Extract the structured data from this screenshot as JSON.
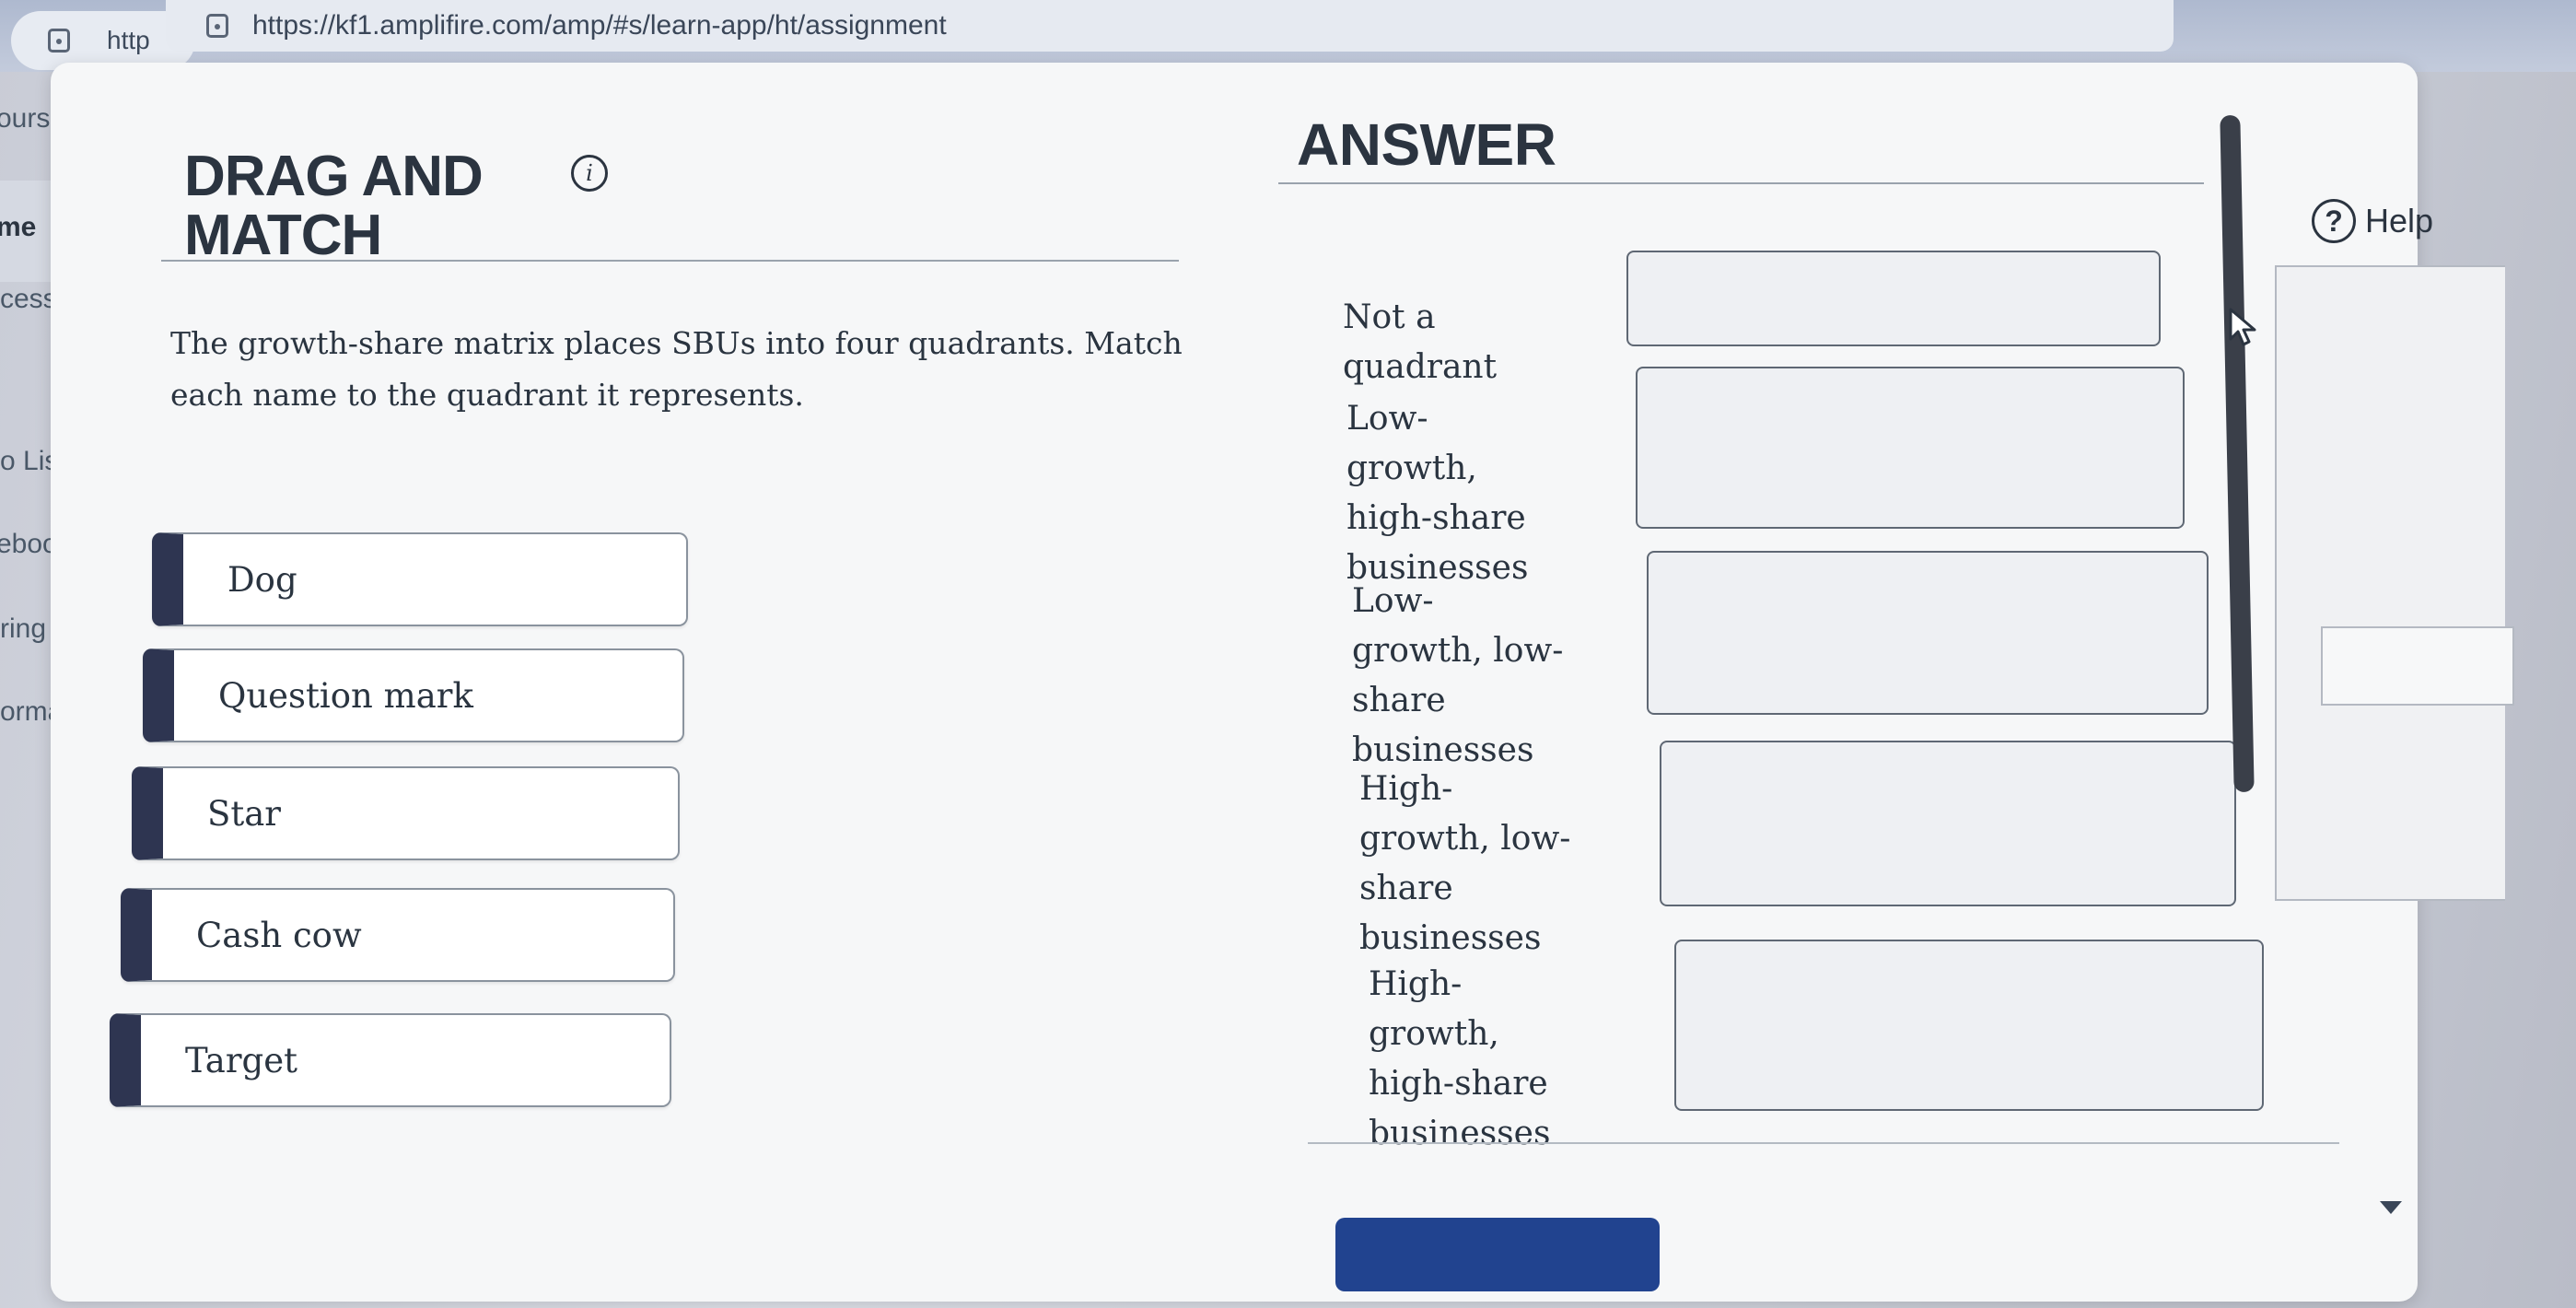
{
  "browser": {
    "back_tab_url": "http",
    "url": "https://kf1.amplifire.com/amp/#s/learn-app/ht/assignment"
  },
  "sidebar": {
    "items": [
      {
        "label": "ourses"
      },
      {
        "label": "me"
      },
      {
        "label": "cess Hub"
      },
      {
        "label": "o List"
      },
      {
        "label": "ebook"
      },
      {
        "label": "ring"
      },
      {
        "label": "ormatio"
      }
    ]
  },
  "question": {
    "title": "DRAG AND MATCH",
    "instructions": "The growth-share matrix places SBUs into four quadrants. Match each name to the quadrant it represents.",
    "options": [
      {
        "label": "Dog"
      },
      {
        "label": "Question mark"
      },
      {
        "label": "Star"
      },
      {
        "label": "Cash cow"
      },
      {
        "label": "Target"
      }
    ]
  },
  "answer": {
    "title": "ANSWER",
    "targets": [
      {
        "label": "Not a quadrant"
      },
      {
        "label": "Low-growth, high-share businesses"
      },
      {
        "label": "Low-growth, low-share businesses"
      },
      {
        "label": "High-growth, low-share businesses"
      },
      {
        "label": "High-growth, high-share businesses"
      }
    ]
  },
  "help": {
    "label": "Help"
  },
  "colors": {
    "accent": "#2e3551",
    "submit": "#21438f"
  }
}
